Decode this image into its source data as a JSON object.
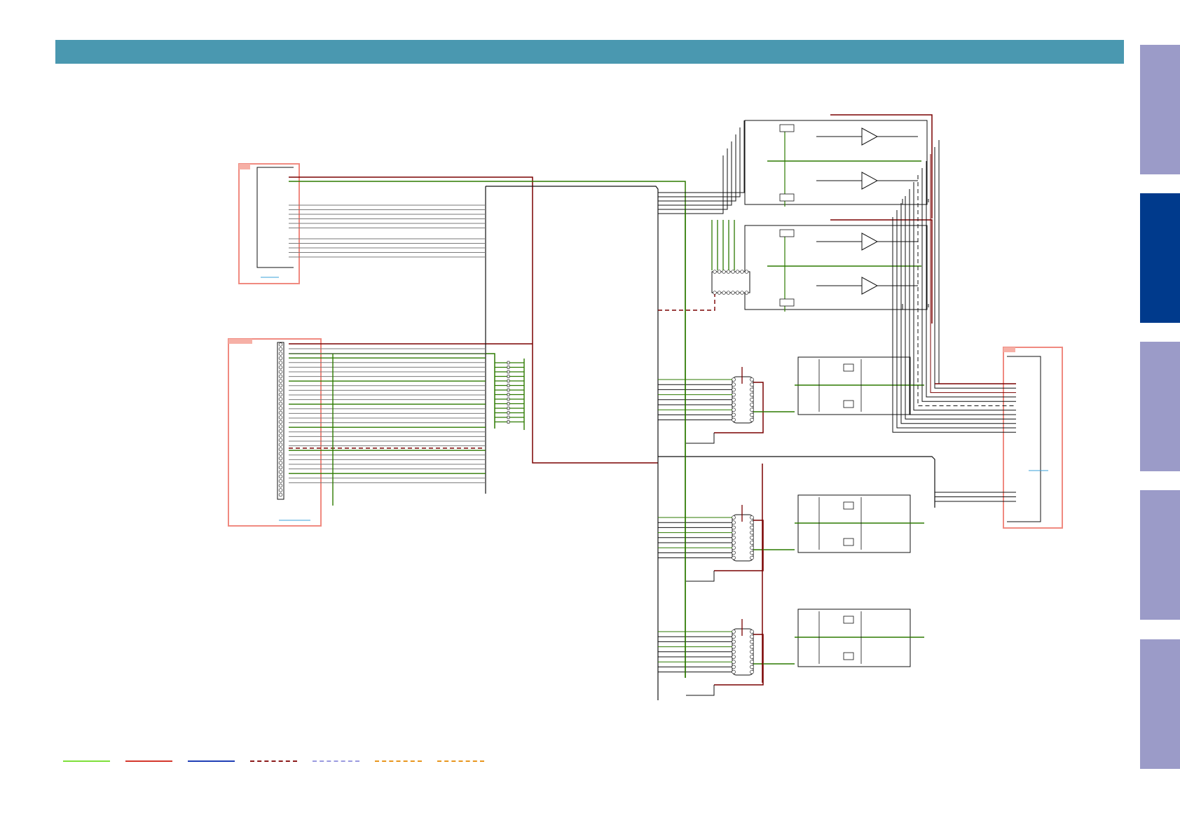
{
  "theme": {
    "header_color": "#4a98b0",
    "tab_color_inactive": "#9b9bc8",
    "tab_color_active": "#003a8c",
    "connector_box_color": "#f08a80",
    "wire_ground": "#2d7a00",
    "wire_power": "#7a0000",
    "wire_signal": "#111111",
    "wire_grey": "#7a7a7a"
  },
  "header": {
    "title": ""
  },
  "side_tabs": [
    {
      "id": "tab-1",
      "state": "inactive"
    },
    {
      "id": "tab-2",
      "state": "active"
    },
    {
      "id": "tab-3",
      "state": "inactive"
    },
    {
      "id": "tab-4",
      "state": "inactive"
    },
    {
      "id": "tab-5",
      "state": "inactive"
    }
  ],
  "legend": {
    "items": [
      {
        "style": "solid",
        "color": "#7ee03a",
        "label": ""
      },
      {
        "style": "solid",
        "color": "#d4372c",
        "label": ""
      },
      {
        "style": "solid",
        "color": "#1f3fb5",
        "label": ""
      },
      {
        "style": "dashed",
        "color": "#8b1a1a",
        "label": ""
      },
      {
        "style": "dashed",
        "color": "#9a9ae0",
        "label": ""
      },
      {
        "style": "dashed",
        "color": "#e8961e",
        "label": ""
      },
      {
        "style": "dashed",
        "color": "#e8961e",
        "label": ""
      }
    ]
  }
}
